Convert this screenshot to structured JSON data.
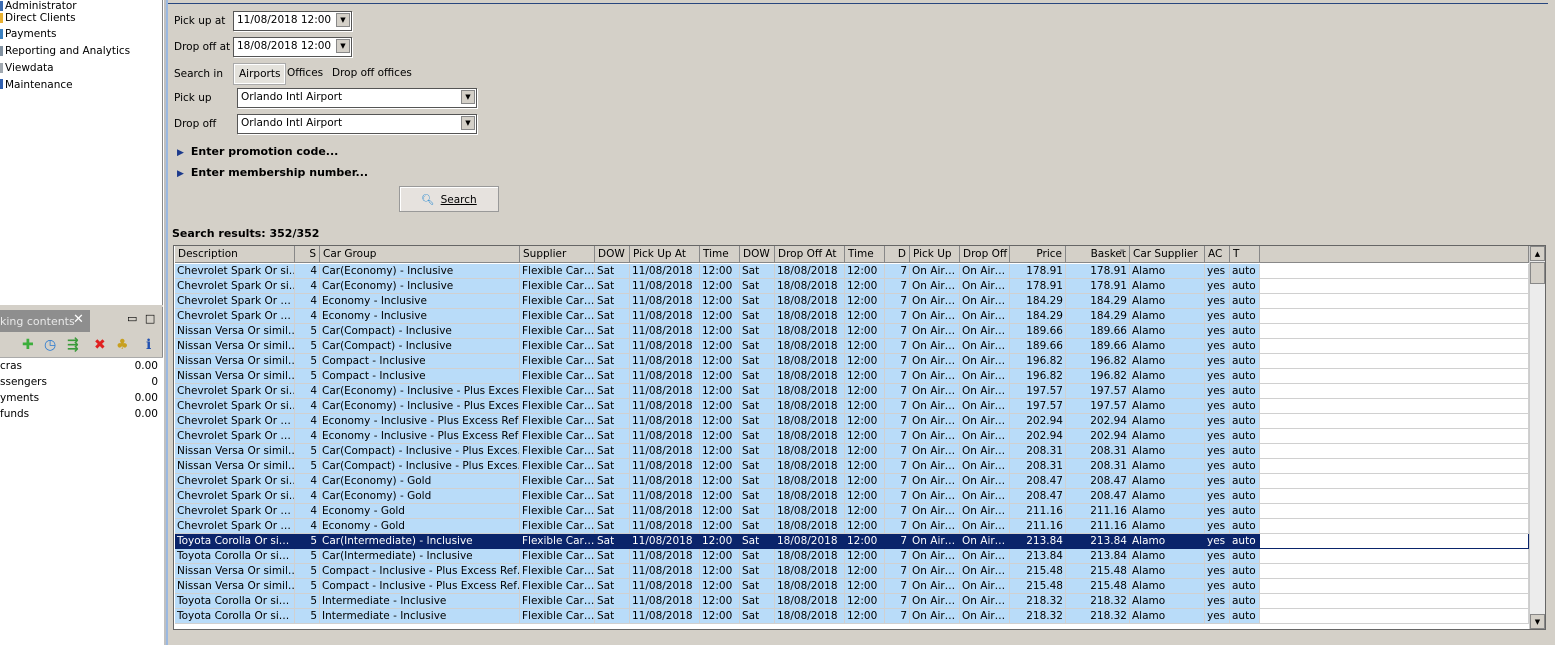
{
  "nav": {
    "items": [
      "Administrator",
      "Direct Clients",
      "Payments",
      "Reporting and Analytics",
      "Viewdata",
      "Maintenance"
    ]
  },
  "booking_panel": {
    "tab_label": "king contents",
    "close": "✕",
    "minimize": "▭",
    "maximize": "□",
    "toolbar_icons": [
      "add-icon",
      "refresh-icon",
      "cart-icon",
      "delete-icon",
      "holiday-icon",
      "info-icon"
    ],
    "summary": [
      {
        "label": "cras",
        "value": "0.00"
      },
      {
        "label": "ssengers",
        "value": "0"
      },
      {
        "label": "yments",
        "value": "0.00"
      },
      {
        "label": "funds",
        "value": "0.00"
      }
    ]
  },
  "form": {
    "pickup_at_label": "Pick up at",
    "pickup_at_value": "11/08/2018 12:00",
    "dropoff_at_label": "Drop off at",
    "dropoff_at_value": "18/08/2018 12:00",
    "search_in_label": "Search in",
    "search_in_options": [
      "Airports",
      "Offices",
      "Drop off offices"
    ],
    "search_in_selected": "Airports",
    "pickup_label": "Pick up",
    "pickup_value": "Orlando Intl Airport",
    "dropoff_label": "Drop off",
    "dropoff_value": "Orlando Intl Airport",
    "promo": "Enter promotion code...",
    "membership": "Enter membership number...",
    "search_button": "Search"
  },
  "results": {
    "label": "Search results: 352/352",
    "columns": [
      "Description",
      "S",
      "Car Group",
      "Supplier",
      "DOW",
      "Pick Up At",
      "Time",
      "DOW",
      "Drop Off At",
      "Time",
      "D",
      "Pick Up",
      "Drop Off",
      "Price",
      "Basket",
      "Car Supplier",
      "AC",
      "T"
    ],
    "sorted_column": "Basket",
    "selected_row": 18,
    "rows": [
      [
        "Chevrolet Spark Or si…",
        "4",
        "Car(Economy) - Inclusive",
        "178.91"
      ],
      [
        "Chevrolet Spark Or si…",
        "4",
        "Car(Economy) - Inclusive",
        "178.91"
      ],
      [
        "Chevrolet  Spark Or …",
        "4",
        "Economy - Inclusive",
        "184.29"
      ],
      [
        "Chevrolet  Spark Or …",
        "4",
        "Economy - Inclusive",
        "184.29"
      ],
      [
        "Nissan Versa Or simil…",
        "5",
        "Car(Compact) - Inclusive",
        "189.66"
      ],
      [
        "Nissan Versa Or simil…",
        "5",
        "Car(Compact) - Inclusive",
        "189.66"
      ],
      [
        "Nissan Versa Or simil…",
        "5",
        "Compact - Inclusive",
        "196.82"
      ],
      [
        "Nissan Versa Or simil…",
        "5",
        "Compact - Inclusive",
        "196.82"
      ],
      [
        "Chevrolet Spark Or si…",
        "4",
        "Car(Economy) - Inclusive - Plus Exces…",
        "197.57"
      ],
      [
        "Chevrolet Spark Or si…",
        "4",
        "Car(Economy) - Inclusive - Plus Exces…",
        "197.57"
      ],
      [
        "Chevrolet  Spark Or …",
        "4",
        "Economy - Inclusive - Plus Excess Ref…",
        "202.94"
      ],
      [
        "Chevrolet  Spark Or …",
        "4",
        "Economy - Inclusive - Plus Excess Ref…",
        "202.94"
      ],
      [
        "Nissan Versa Or simil…",
        "5",
        "Car(Compact) - Inclusive - Plus Exces…",
        "208.31"
      ],
      [
        "Nissan Versa Or simil…",
        "5",
        "Car(Compact) - Inclusive - Plus Exces…",
        "208.31"
      ],
      [
        "Chevrolet Spark Or si…",
        "4",
        "Car(Economy) - Gold",
        "208.47"
      ],
      [
        "Chevrolet Spark Or si…",
        "4",
        "Car(Economy) - Gold",
        "208.47"
      ],
      [
        "Chevrolet  Spark Or …",
        "4",
        "Economy - Gold",
        "211.16"
      ],
      [
        "Chevrolet  Spark Or …",
        "4",
        "Economy - Gold",
        "211.16"
      ],
      [
        "Toyota Corolla Or si…",
        "5",
        "Car(Intermediate) - Inclusive",
        "213.84"
      ],
      [
        "Toyota Corolla Or si…",
        "5",
        "Car(Intermediate) - Inclusive",
        "213.84"
      ],
      [
        "Nissan Versa Or simil…",
        "5",
        "Compact - Inclusive - Plus Excess Ref…",
        "215.48"
      ],
      [
        "Nissan Versa Or simil…",
        "5",
        "Compact - Inclusive - Plus Excess Ref…",
        "215.48"
      ],
      [
        "Toyota Corolla Or si…",
        "5",
        "Intermediate - Inclusive",
        "218.32"
      ],
      [
        "Toyota Corolla Or si…",
        "5",
        "Intermediate - Inclusive",
        "218.32"
      ]
    ],
    "common": {
      "supplier": "Flexible Car…",
      "dow_pickup": "Sat",
      "pickup_date": "11/08/2018",
      "pickup_time": "12:00",
      "dow_dropoff": "Sat",
      "dropoff_date": "18/08/2018",
      "dropoff_time": "12:00",
      "days": "7",
      "pickup_loc": "On Air…",
      "dropoff_loc": "On Air…",
      "car_supplier": "Alamo",
      "ac": "yes",
      "transmission": "auto"
    }
  },
  "colors": {
    "row_bg": "#b9dcf9",
    "selected_bg": "#0a246a",
    "chrome": "#d4d0c8"
  }
}
